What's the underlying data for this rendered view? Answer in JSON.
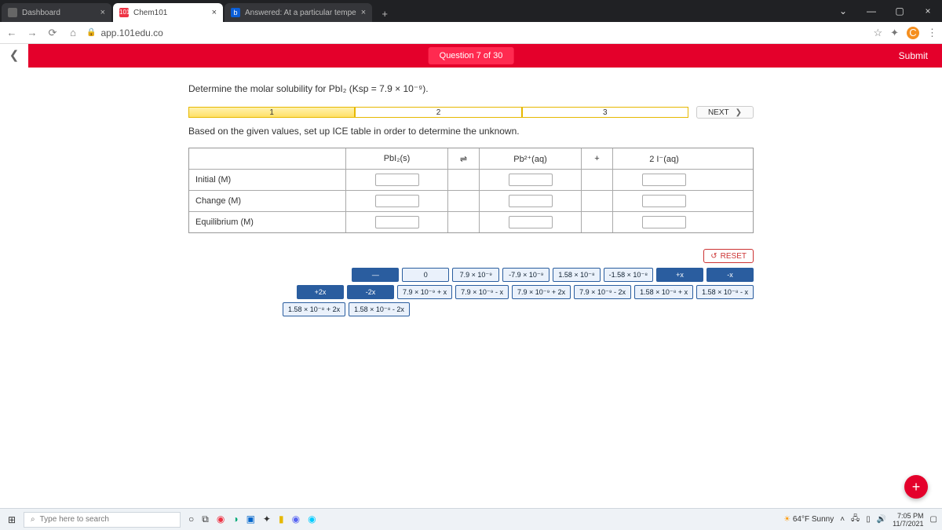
{
  "browser": {
    "tabs": [
      {
        "title": "Dashboard"
      },
      {
        "title": "Chem101"
      },
      {
        "title": "Answered: At a particular tempe"
      }
    ],
    "url": "app.101edu.co",
    "profile_letter": "C"
  },
  "banner": {
    "question_label": "Question 7 of 30",
    "submit": "Submit"
  },
  "prompt": "Determine the molar solubility for PbI₂ (Ksp = 7.9 × 10⁻⁹).",
  "steps": {
    "s1": "1",
    "s2": "2",
    "s3": "3",
    "next": "NEXT"
  },
  "instruction": "Based on the given values, set up ICE table in order to determine the unknown.",
  "ice": {
    "head": {
      "c1": "PbI₂(s)",
      "op1": "⇌",
      "c2": "Pb²⁺(aq)",
      "op2": "+",
      "c3": "2 I⁻(aq)"
    },
    "rows": {
      "r1": "Initial (M)",
      "r2": "Change (M)",
      "r3": "Equilibrium (M)"
    }
  },
  "reset": "RESET",
  "tiles": {
    "t0": "—",
    "t1": "0",
    "t2": "7.9 × 10⁻⁹",
    "t3": "-7.9 × 10⁻⁹",
    "t4": "1.58 × 10⁻⁸",
    "t5": "-1.58 × 10⁻⁸",
    "t6": "+x",
    "t7": "-x",
    "t8": "+2x",
    "t9": "-2x",
    "t10": "7.9 × 10⁻⁹ + x",
    "t11": "7.9 × 10⁻⁹ - x",
    "t12": "7.9 × 10⁻⁹ + 2x",
    "t13": "7.9 × 10⁻⁹ - 2x",
    "t14": "1.58 × 10⁻⁸ + x",
    "t15": "1.58 × 10⁻⁸ - x",
    "t16": "1.58 × 10⁻⁸ + 2x",
    "t17": "1.58 × 10⁻⁸ - 2x"
  },
  "taskbar": {
    "search_placeholder": "Type here to search",
    "weather": "64°F Sunny",
    "time": "7:05 PM",
    "date": "11/7/2021"
  }
}
